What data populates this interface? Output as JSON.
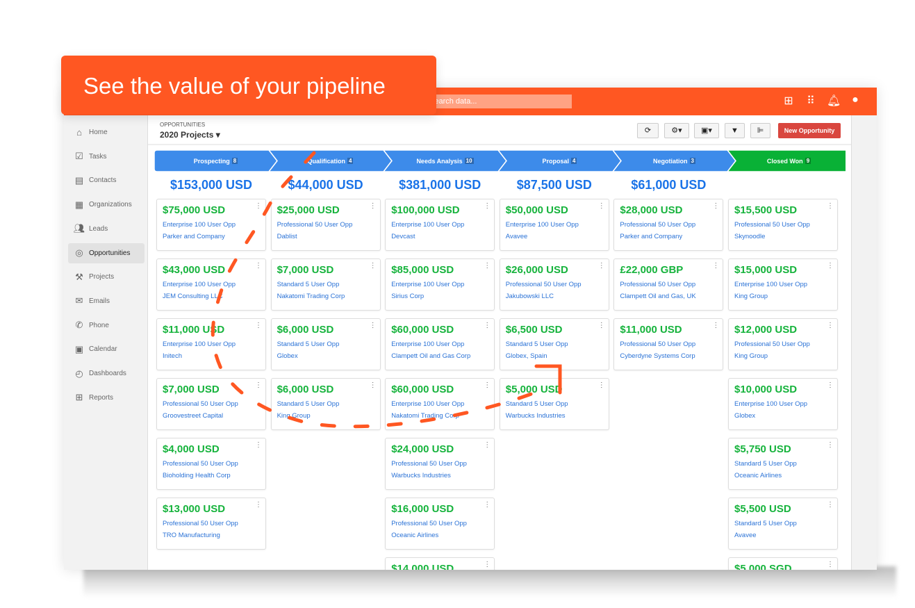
{
  "banner": {
    "text": "See the value of your pipeline"
  },
  "topbar": {
    "search_placeholder": "Search data...",
    "icons": [
      "plus-square-icon",
      "apps-grid-icon",
      "bell-icon",
      "account-icon"
    ]
  },
  "sidebar": {
    "items": [
      {
        "label": "Home",
        "icon": "home-icon"
      },
      {
        "label": "Tasks",
        "icon": "tasks-icon"
      },
      {
        "label": "Contacts",
        "icon": "contacts-icon"
      },
      {
        "label": "Organizations",
        "icon": "organizations-icon"
      },
      {
        "label": "Leads",
        "icon": "leads-icon"
      },
      {
        "label": "Opportunities",
        "icon": "target-icon",
        "active": true
      },
      {
        "label": "Projects",
        "icon": "hammer-icon"
      },
      {
        "label": "Emails",
        "icon": "mail-icon"
      },
      {
        "label": "Phone",
        "icon": "phone-icon"
      },
      {
        "label": "Calendar",
        "icon": "calendar-icon"
      },
      {
        "label": "Dashboards",
        "icon": "dashboard-icon"
      },
      {
        "label": "Reports",
        "icon": "reports-icon"
      }
    ]
  },
  "header": {
    "breadcrumb": "OPPORTUNITIES",
    "title": "2020 Projects",
    "new_button": "New Opportunity"
  },
  "colors": {
    "accent": "#FF5722",
    "stage_blue": "#3d8bea",
    "stage_green": "#09b136",
    "amount_green": "#16b33c",
    "link_blue": "#2a72d6",
    "new_button": "#d9463e"
  },
  "stages": [
    {
      "label": "Prospecting",
      "count": "8",
      "total": "$153,000 USD",
      "cards": [
        {
          "amount": "$75,000 USD",
          "name": "Enterprise 100 User Opp",
          "org": "Parker and Company"
        },
        {
          "amount": "$43,000 USD",
          "name": "Enterprise 100 User Opp",
          "org": "JEM Consulting LLC"
        },
        {
          "amount": "$11,000 USD",
          "name": "Enterprise 100 User Opp",
          "org": "Initech"
        },
        {
          "amount": "$7,000 USD",
          "name": "Professional 50 User Opp",
          "org": "Groovestreet Capital"
        },
        {
          "amount": "$4,000 USD",
          "name": "Professional 50 User Opp",
          "org": "Bioholding Health Corp"
        },
        {
          "amount": "$13,000 USD",
          "name": "Professional 50 User Opp",
          "org": "TRO Manufacturing"
        }
      ]
    },
    {
      "label": "Qualification",
      "count": "4",
      "total": "$44,000 USD",
      "cards": [
        {
          "amount": "$25,000 USD",
          "name": "Professional 50 User Opp",
          "org": "Dablist"
        },
        {
          "amount": "$7,000 USD",
          "name": "Standard 5 User Opp",
          "org": "Nakatomi Trading Corp"
        },
        {
          "amount": "$6,000 USD",
          "name": "Standard 5 User Opp",
          "org": "Globex"
        },
        {
          "amount": "$6,000 USD",
          "name": "Standard 5 User Opp",
          "org": "King Group"
        }
      ]
    },
    {
      "label": "Needs Analysis",
      "count": "10",
      "total": "$381,000 USD",
      "cards": [
        {
          "amount": "$100,000 USD",
          "name": "Enterprise 100 User Opp",
          "org": "Devcast"
        },
        {
          "amount": "$85,000 USD",
          "name": "Enterprise 100 User Opp",
          "org": "Sirius Corp"
        },
        {
          "amount": "$60,000 USD",
          "name": "Enterprise 100 User Opp",
          "org": "Clampett Oil and Gas Corp"
        },
        {
          "amount": "$60,000 USD",
          "name": "Enterprise 100 User Opp",
          "org": "Nakatomi Trading Corp"
        },
        {
          "amount": "$24,000 USD",
          "name": "Professional 50 User Opp",
          "org": "Warbucks Industries"
        },
        {
          "amount": "$16,000 USD",
          "name": "Professional 50 User Opp",
          "org": "Oceanic Airlines"
        },
        {
          "amount": "$14,000 USD",
          "name": "",
          "org": ""
        }
      ]
    },
    {
      "label": "Proposal",
      "count": "4",
      "total": "$87,500 USD",
      "cards": [
        {
          "amount": "$50,000 USD",
          "name": "Enterprise 100 User Opp",
          "org": "Avavee"
        },
        {
          "amount": "$26,000 USD",
          "name": "Professional 50 User Opp",
          "org": "Jakubowski LLC"
        },
        {
          "amount": "$6,500 USD",
          "name": "Standard 5 User Opp",
          "org": "Globex, Spain"
        },
        {
          "amount": "$5,000 USD",
          "name": "Standard 5 User Opp",
          "org": "Warbucks Industries"
        }
      ]
    },
    {
      "label": "Negotiation",
      "count": "3",
      "total": "$61,000 USD",
      "cards": [
        {
          "amount": "$28,000 USD",
          "name": "Professional 50 User Opp",
          "org": "Parker and Company"
        },
        {
          "amount": "£22,000 GBP",
          "name": "Professional 50 User Opp",
          "org": "Clampett Oil and Gas, UK"
        },
        {
          "amount": "$11,000 USD",
          "name": "Professional 50 User Opp",
          "org": "Cyberdyne Systems Corp"
        }
      ]
    },
    {
      "label": "Closed Won",
      "count": "9",
      "total": "",
      "won": true,
      "cards": [
        {
          "amount": "$15,500 USD",
          "name": "Professional 50 User Opp",
          "org": "Skynoodle"
        },
        {
          "amount": "$15,000 USD",
          "name": "Enterprise 100 User Opp",
          "org": "King Group"
        },
        {
          "amount": "$12,000 USD",
          "name": "Professional 50 User Opp",
          "org": "King Group"
        },
        {
          "amount": "$10,000 USD",
          "name": "Enterprise 100 User Opp",
          "org": "Globex"
        },
        {
          "amount": "$5,750 USD",
          "name": "Standard 5 User Opp",
          "org": "Oceanic Airlines"
        },
        {
          "amount": "$5,500 USD",
          "name": "Standard 5 User Opp",
          "org": "Avavee"
        },
        {
          "amount": "$5,000 SGD",
          "name": "",
          "org": ""
        }
      ]
    }
  ]
}
